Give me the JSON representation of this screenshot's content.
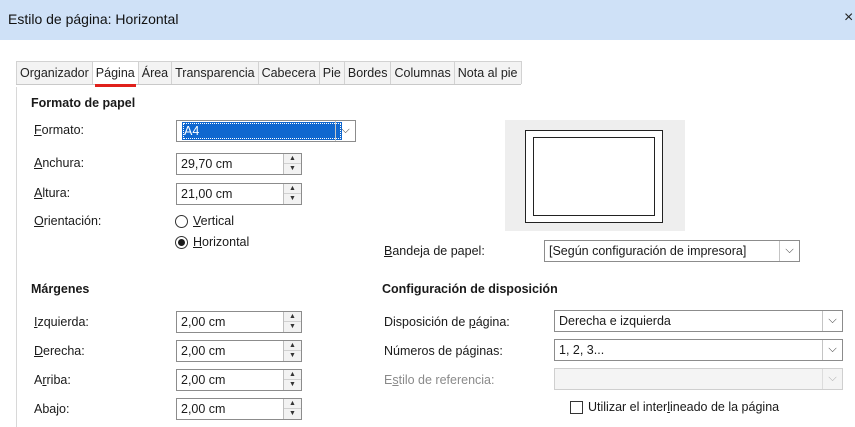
{
  "window": {
    "title": "Estilo de página: Horizontal",
    "close_icon": "×"
  },
  "tabs": [
    {
      "label": "Organizador",
      "active": false
    },
    {
      "label": "Página",
      "active": true
    },
    {
      "label": "Área",
      "active": false
    },
    {
      "label": "Transparencia",
      "active": false
    },
    {
      "label": "Cabecera",
      "active": false
    },
    {
      "label": "Pie",
      "active": false
    },
    {
      "label": "Bordes",
      "active": false
    },
    {
      "label": "Columnas",
      "active": false
    },
    {
      "label": "Nota al pie",
      "active": false
    }
  ],
  "paper_format": {
    "heading": "Formato de papel",
    "format": {
      "label_acc": "F",
      "label_rest": "ormato:",
      "value": "A4"
    },
    "width": {
      "label_acc": "A",
      "label_rest": "nchura:",
      "value": "29,70 cm"
    },
    "height": {
      "label_acc": "A",
      "label_rest": "ltura:",
      "value": "21,00 cm"
    },
    "orientation": {
      "label_acc": "O",
      "label_rest": "rientación:",
      "vertical": {
        "acc": "V",
        "rest": "ertical",
        "selected": false
      },
      "horizontal": {
        "acc": "H",
        "rest": "orizontal",
        "selected": true
      }
    },
    "paper_tray": {
      "label_acc": "B",
      "label_rest": "andeja de papel:",
      "value": "[Según configuración de impresora]"
    }
  },
  "margins": {
    "heading": "Márgenes",
    "left": {
      "label_acc": "I",
      "label_rest": "zquierda:",
      "value": "2,00 cm"
    },
    "right": {
      "label_acc": "D",
      "label_rest": "erecha:",
      "value": "2,00 cm"
    },
    "top": {
      "label_pre": "A",
      "label_acc": "r",
      "label_rest": "riba:",
      "value": "2,00 cm"
    },
    "bottom": {
      "label": "Abajo:",
      "value": "2,00 cm"
    }
  },
  "layout": {
    "heading": "Configuración de disposición",
    "page_layout": {
      "label_pre": "Disposición de ",
      "label_acc": "p",
      "label_rest": "ágina:",
      "value": "Derecha e izquierda"
    },
    "page_numbers": {
      "label": "Números de páginas:",
      "value": "1, 2, 3..."
    },
    "reference_style": {
      "label_pre": "E",
      "label_acc": "s",
      "label_rest": "tilo de referencia:",
      "value": "",
      "disabled": true
    },
    "register_true": {
      "label_pre": "Utilizar el inter",
      "label_acc": "l",
      "label_rest": "ineado de la página",
      "checked": false
    }
  }
}
